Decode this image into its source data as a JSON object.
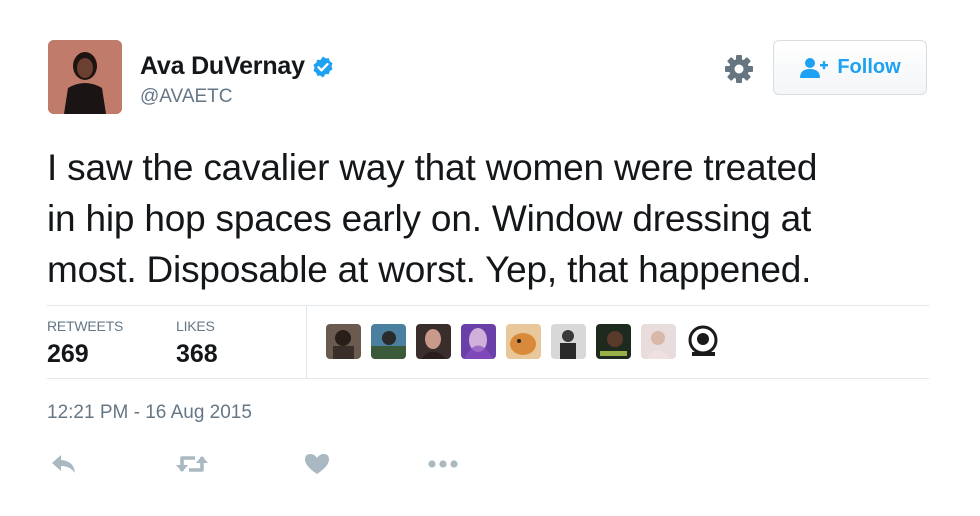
{
  "author": {
    "name": "Ava DuVernay",
    "handle": "@AVAETC",
    "verified": true
  },
  "follow_button": {
    "label": "Follow",
    "icon": "add-user-icon"
  },
  "settings_icon": "gear-icon",
  "tweet": {
    "line1": "I saw the cavalier way that women were treated",
    "line2": "in hip hop spaces early on. Window dressing at",
    "line3": "most. Disposable at worst. Yep, that happened."
  },
  "stats": {
    "retweets_label": "RETWEETS",
    "retweets_count": "269",
    "likes_label": "LIKES",
    "likes_count": "368"
  },
  "liker_avatars": [
    {
      "color": "#5a4a42"
    },
    {
      "color": "#3e6f8c"
    },
    {
      "color": "#4a3a38"
    },
    {
      "color": "#8a4fc2"
    },
    {
      "color": "#d88a3a"
    },
    {
      "color": "#b8b8b8"
    },
    {
      "color": "#2d3a2a"
    },
    {
      "color": "#d8c8c8"
    },
    {
      "color": "#ffffff"
    }
  ],
  "timestamp": "12:21 PM - 16 Aug 2015",
  "actions": [
    "reply-icon",
    "retweet-icon",
    "like-icon",
    "more-icon"
  ],
  "colors": {
    "accent": "#1da1f2",
    "secondary_text": "#657786",
    "icon_gray": "#aab8c2"
  }
}
